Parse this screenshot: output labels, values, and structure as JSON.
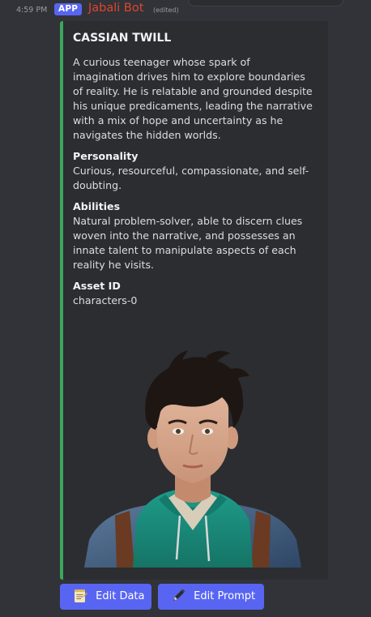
{
  "message": {
    "timestamp": "4:59 PM",
    "badge": "APP",
    "author": "Jabali Bot",
    "edited_label": "(edited)"
  },
  "embed": {
    "accent_color": "#3ba55d",
    "title": "CASSIAN TWILL",
    "description": "A curious teenager whose spark of imagination drives him to explore boundaries of reality. He is relatable and grounded despite his unique predicaments, leading the narrative with a mix of hope and uncertainty as he navigates the hidden worlds.",
    "fields": [
      {
        "name": "Personality",
        "value": "Curious, resourceful, compassionate, and self-doubting."
      },
      {
        "name": "Abilities",
        "value": "Natural problem-solver, able to discern clues woven into the narrative, and possesses an innate talent to manipulate aspects of each reality he visits."
      },
      {
        "name": "Asset ID",
        "value": "characters-0"
      }
    ],
    "image_icon": "character-portrait"
  },
  "buttons": {
    "edit_data": {
      "label": "Edit Data",
      "icon": "memo-icon"
    },
    "edit_prompt": {
      "label": "Edit Prompt",
      "icon": "pen-icon"
    }
  },
  "colors": {
    "background": "#313338",
    "embed_background": "#2b2d31",
    "button": "#5865f2",
    "author": "#e0452e",
    "badge": "#5865f2"
  }
}
